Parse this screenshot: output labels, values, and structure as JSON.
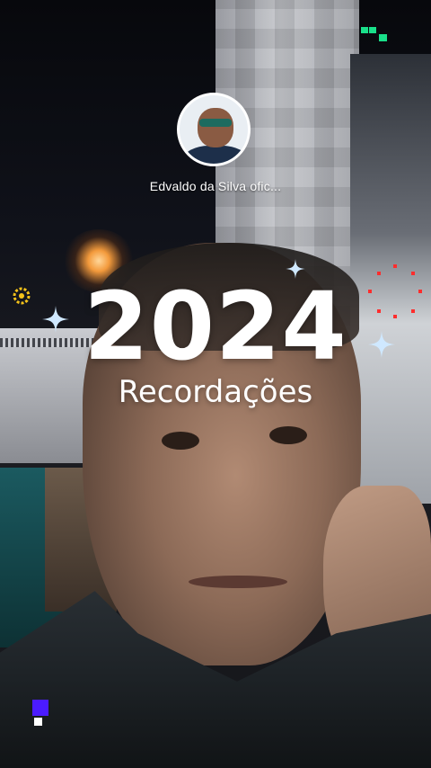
{
  "story": {
    "account_name": "Edvaldo da Silva ofic...",
    "headline_year": "2024",
    "headline_subtitle": "Recordações"
  },
  "icons": {
    "avatar": "profile-avatar",
    "sparkle": "sparkle-icon",
    "gear": "gear-decoration-icon",
    "pixels": "pixel-decoration-icon"
  },
  "colors": {
    "text": "#ffffff",
    "accent_green": "#19e08a",
    "accent_blue": "#4b1bff",
    "sparkle": "#cfe8ff",
    "gear": "#f4c21a",
    "dots": "#ff2d2d"
  }
}
